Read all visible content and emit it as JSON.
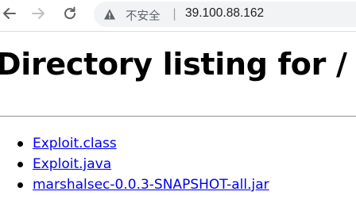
{
  "browser": {
    "back_icon": "arrow-left-icon",
    "forward_icon": "arrow-right-icon",
    "reload_icon": "reload-icon",
    "security_icon": "warning-triangle-icon",
    "security_label": "不安全",
    "separator": "|",
    "url": "39.100.88.162"
  },
  "page": {
    "title": "Directory listing for /",
    "files": [
      {
        "name": "Exploit.class"
      },
      {
        "name": "Exploit.java"
      },
      {
        "name": "marshalsec-0.0.3-SNAPSHOT-all.jar"
      }
    ]
  },
  "colors": {
    "link": "#0000ee",
    "omnibox_bg": "#f1f3f4",
    "text": "#000000"
  }
}
